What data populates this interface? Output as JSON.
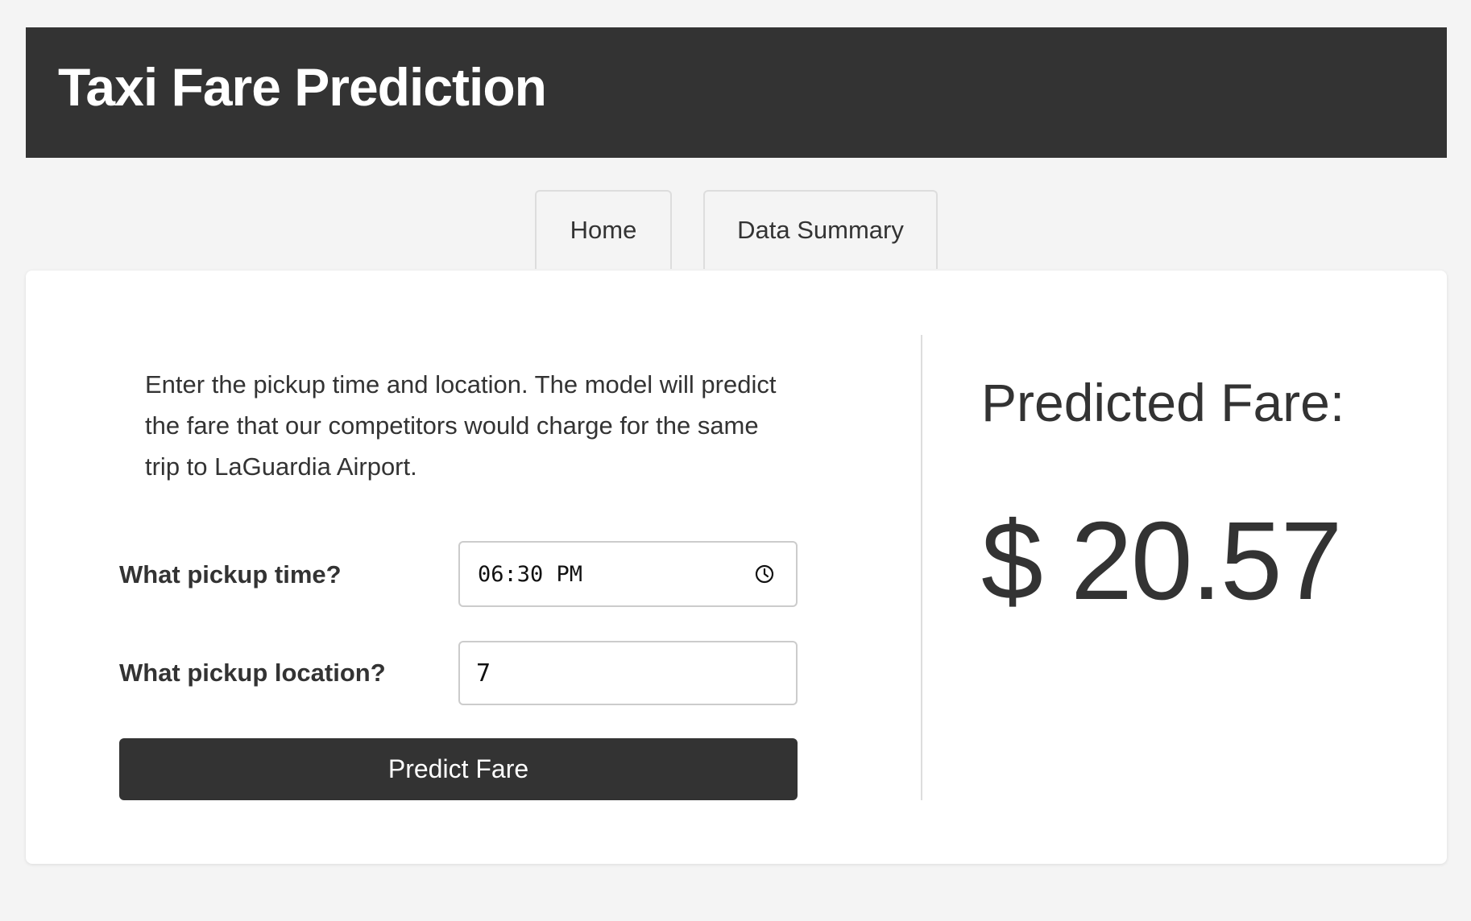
{
  "header": {
    "title": "Taxi Fare Prediction"
  },
  "tabs": [
    {
      "label": "Home",
      "active": true
    },
    {
      "label": "Data Summary",
      "active": false
    }
  ],
  "form": {
    "description": "Enter the pickup time and location. The model will predict the fare that our competitors would charge for the same trip to LaGuardia Airport.",
    "time_label": "What pickup time?",
    "time_value": "06:30 PM",
    "location_label": "What pickup location?",
    "location_value": "7",
    "button_label": "Predict Fare"
  },
  "result": {
    "heading": "Predicted Fare:",
    "value": "$ 20.57"
  },
  "icons": {
    "time_input": "clock-icon"
  },
  "colors": {
    "header_bg": "#333333",
    "button_bg": "#333333",
    "page_bg": "#f4f4f4"
  }
}
